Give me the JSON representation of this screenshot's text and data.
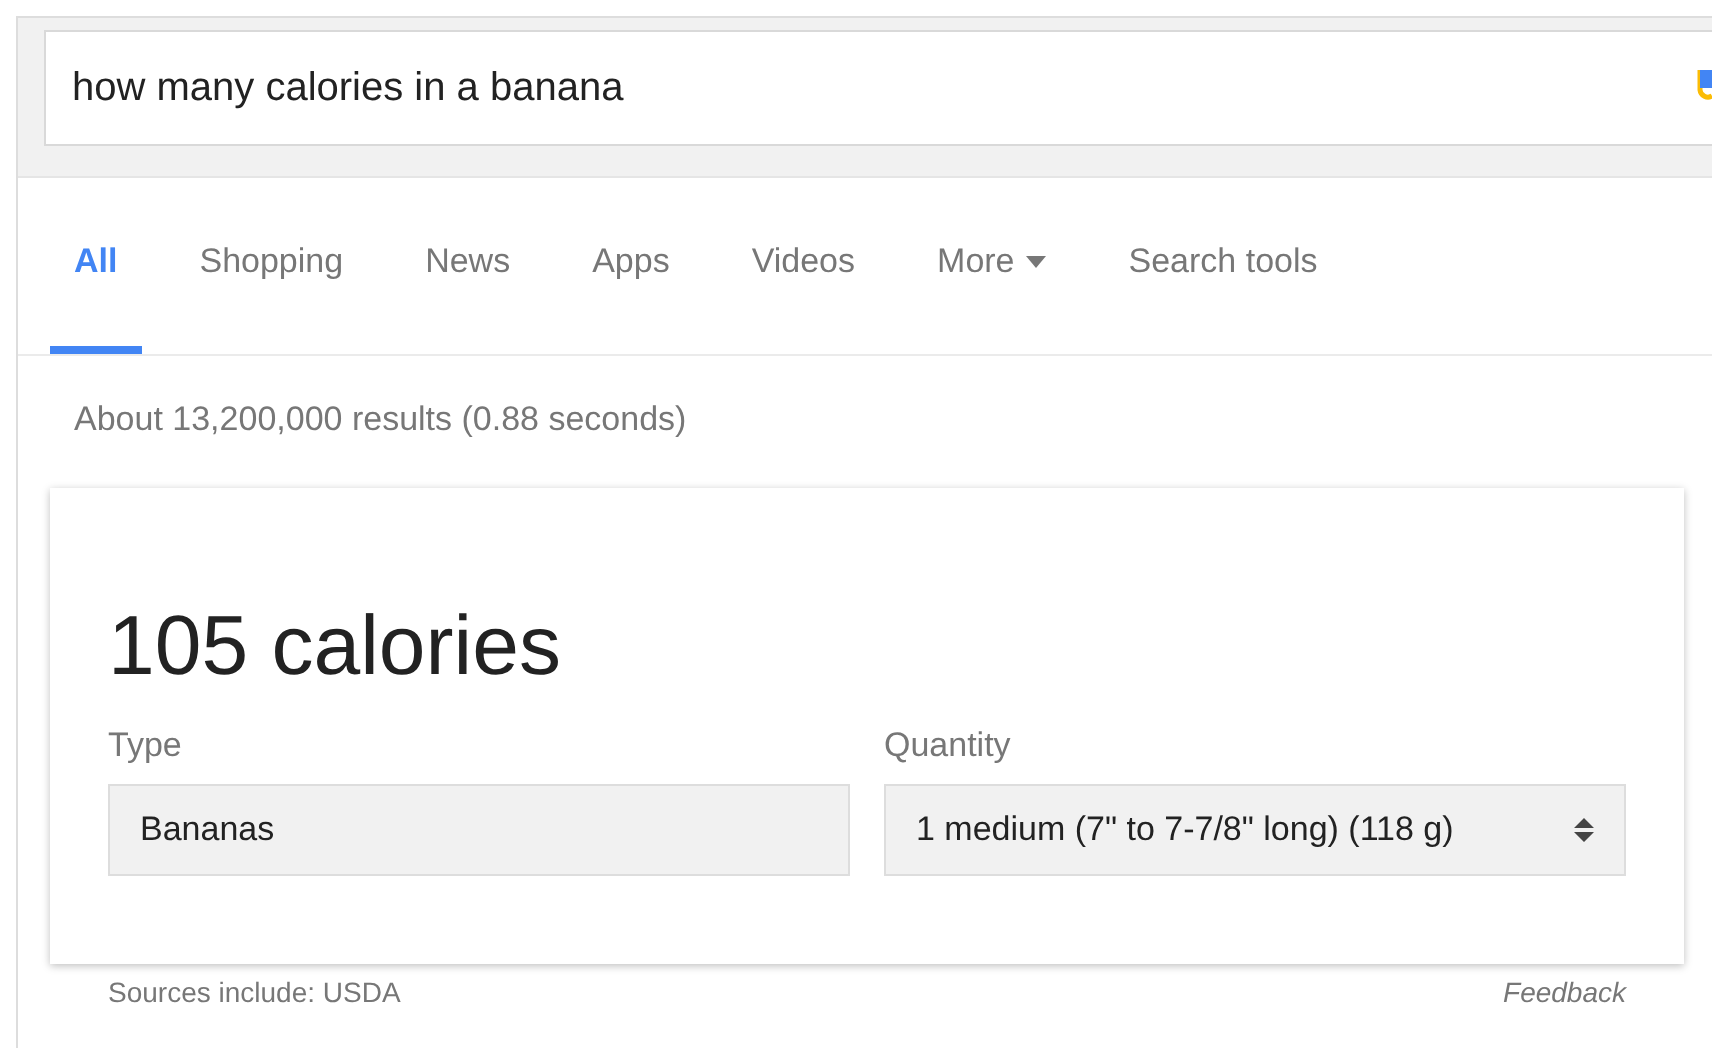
{
  "search": {
    "value": "how many calories in a banana"
  },
  "tabs": [
    {
      "label": "All",
      "selected": true,
      "kind": "tab"
    },
    {
      "label": "Shopping",
      "selected": false,
      "kind": "tab"
    },
    {
      "label": "News",
      "selected": false,
      "kind": "tab"
    },
    {
      "label": "Apps",
      "selected": false,
      "kind": "tab"
    },
    {
      "label": "Videos",
      "selected": false,
      "kind": "tab"
    },
    {
      "label": "More",
      "selected": false,
      "kind": "menu"
    },
    {
      "label": "Search tools",
      "selected": false,
      "kind": "tab"
    }
  ],
  "result_stats": "About 13,200,000 results (0.88 seconds)",
  "card": {
    "headline": "105 calories",
    "fields": [
      {
        "label": "Type",
        "value": "Bananas",
        "kind": "text"
      },
      {
        "label": "Quantity",
        "value": "1 medium (7\" to 7-7/8\" long) (118 g)",
        "kind": "select"
      }
    ]
  },
  "footer": {
    "source": "Sources include: USDA",
    "feedback": "Feedback"
  }
}
